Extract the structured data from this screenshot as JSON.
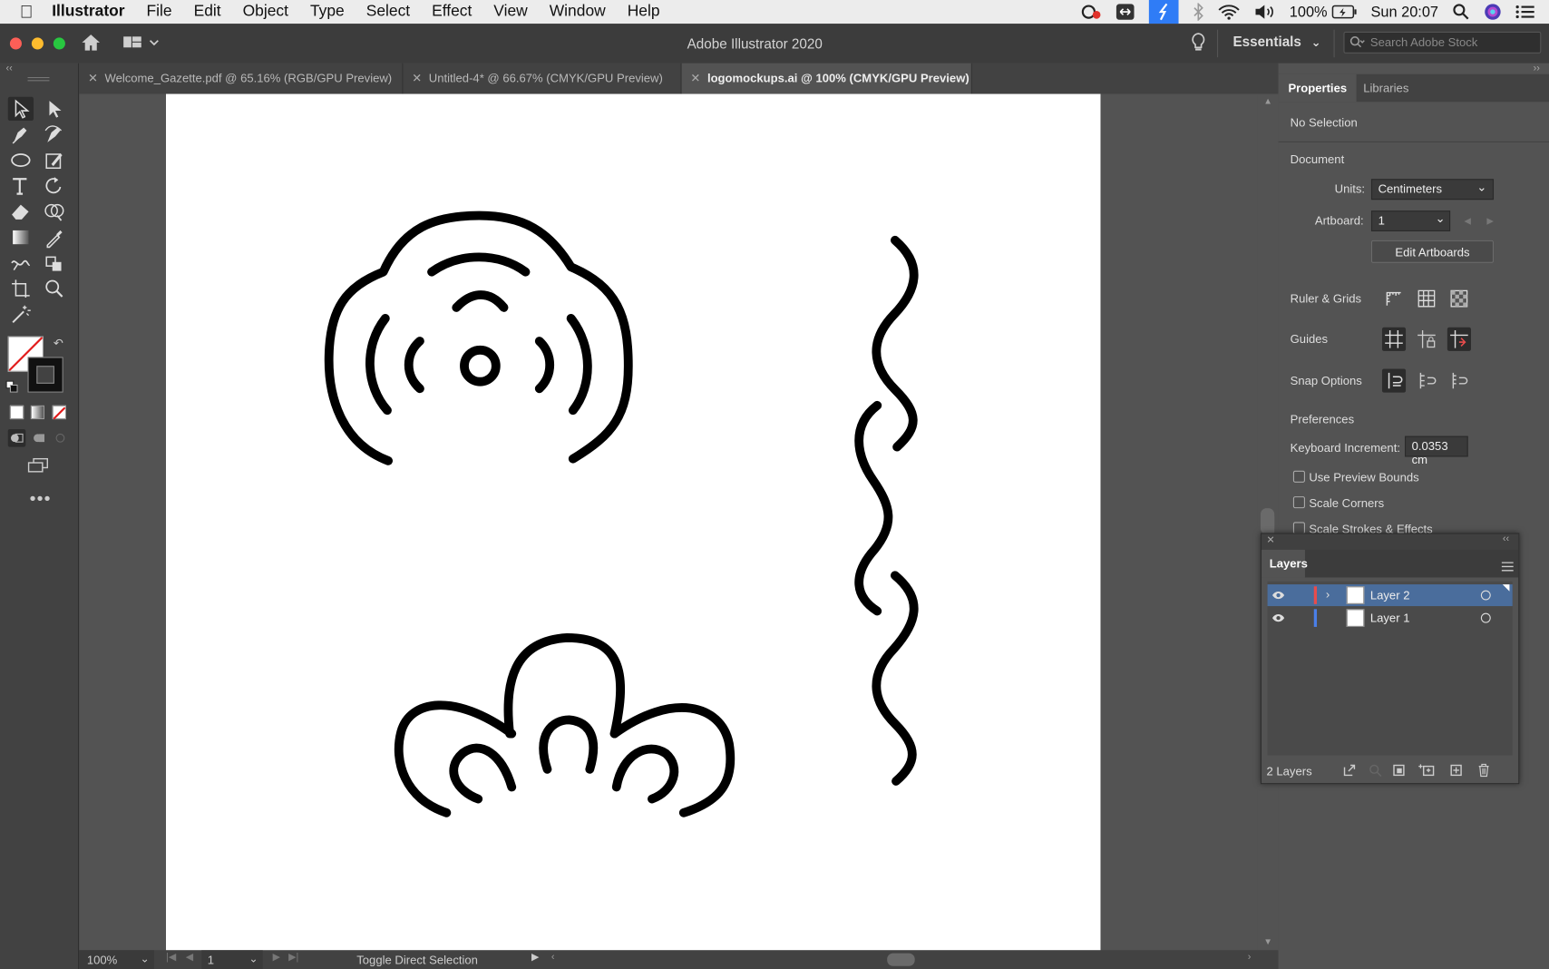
{
  "menubar": {
    "app_name": "Illustrator",
    "items": [
      "File",
      "Edit",
      "Object",
      "Type",
      "Select",
      "Effect",
      "View",
      "Window",
      "Help"
    ],
    "battery": "100%",
    "clock": "Sun 20:07"
  },
  "appbar": {
    "title": "Adobe Illustrator 2020",
    "workspace": "Essentials",
    "search_placeholder": "Search Adobe Stock"
  },
  "tabs": [
    {
      "label": "Welcome_Gazette.pdf @ 65.16% (RGB/GPU Preview)",
      "active": false
    },
    {
      "label": "Untitled-4* @ 66.67% (CMYK/GPU Preview)",
      "active": false
    },
    {
      "label": "logomockups.ai @ 100% (CMYK/GPU Preview)",
      "active": true
    }
  ],
  "status": {
    "zoom": "100%",
    "artboard": "1",
    "tool_hint": "Toggle Direct Selection"
  },
  "properties": {
    "tab_properties": "Properties",
    "tab_libraries": "Libraries",
    "selection": "No Selection",
    "document": "Document",
    "units_label": "Units:",
    "units_value": "Centimeters",
    "artboard_label": "Artboard:",
    "artboard_value": "1",
    "edit_artboards": "Edit Artboards",
    "ruler_grids": "Ruler & Grids",
    "guides": "Guides",
    "snap_options": "Snap Options",
    "preferences": "Preferences",
    "keyboard_increment_label": "Keyboard Increment:",
    "keyboard_increment_value": "0.0353 cm",
    "use_preview_bounds": "Use Preview Bounds",
    "scale_corners": "Scale Corners",
    "scale_strokes": "Scale Strokes & Effects"
  },
  "layers": {
    "title": "Layers",
    "rows": [
      {
        "name": "Layer 2",
        "color": "#e84c4c",
        "selected": true
      },
      {
        "name": "Layer 1",
        "color": "#4a7fe8",
        "selected": false
      }
    ],
    "count": "2 Layers"
  },
  "colors": {
    "accent": "#4a6d9c",
    "menubar": "#ececec",
    "panel": "#535353"
  }
}
